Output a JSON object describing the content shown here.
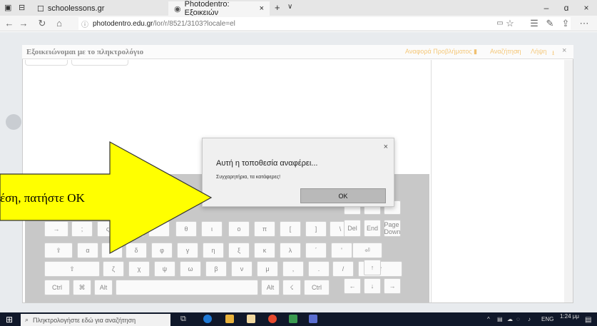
{
  "browser": {
    "tabs": [
      {
        "label": "schoolessons.gr"
      },
      {
        "label": "Photodentro: Εξοικειών",
        "close": "×"
      }
    ],
    "new_tab": "+",
    "tab_menu": "∨",
    "window_controls": {
      "minimize": "–",
      "maximize": "ɑ",
      "close": "×"
    },
    "url": {
      "host": "photodentro.edu.gr",
      "path": "/lor/r/8521/3103?locale=el"
    }
  },
  "panel": {
    "title": "Εξοικειώνομαι με το πληκτρολόγιο",
    "links": {
      "report": "Αναφορά Προβλήματος",
      "search": "Αναζήτηση",
      "download": "Λήψη",
      "close": "×"
    }
  },
  "keyboard": {
    "row1": [
      "→",
      ";",
      "ς",
      "",
      "",
      "θ",
      "ι",
      "ο",
      "π",
      "[",
      "]",
      "\\"
    ],
    "row2": [
      "⇪",
      "α",
      "σ",
      "δ",
      "φ",
      "γ",
      "η",
      "ξ",
      "κ",
      "λ",
      "΄",
      "'",
      "⏎"
    ],
    "row3": [
      "⇧",
      "ζ",
      "χ",
      "ψ",
      "ω",
      "β",
      "ν",
      "μ",
      ",",
      ".",
      "/",
      "⇧"
    ],
    "row4": {
      "ctrl_left": "Ctrl",
      "cmd": "⌘",
      "alt_left": "Alt",
      "alt_right": "Alt",
      "menu": "☇",
      "ctrl_right": "Ctrl"
    },
    "nav": {
      "del": "Del",
      "end": "End",
      "page_down": "Page Down",
      "up": "↑",
      "left": "←",
      "down": "↓",
      "right": "→"
    }
  },
  "dialog": {
    "close": "×",
    "title": "Αυτή η τοποθεσία αναφέρει...",
    "message": "Συγχαρητήρια, τα κατάφερες!",
    "ok": "OK"
  },
  "callout": {
    "text": "έση, πατήστε OK",
    "color": "#ffff00"
  },
  "taskbar": {
    "search_placeholder": "Πληκτρολογήστε εδώ για αναζήτηση",
    "language": "ENG",
    "time": "1:24 μμ"
  }
}
